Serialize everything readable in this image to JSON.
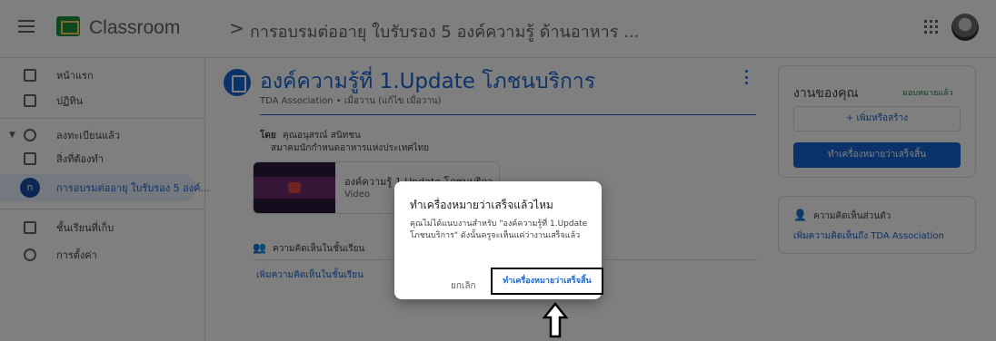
{
  "header": {
    "app_name": "Classroom",
    "separator": ">",
    "course": "การอบรมต่ออายุ ใบรับรอง 5 องค์ความรู้ ด้านอาหาร ..."
  },
  "sidebar": {
    "items": [
      {
        "label": "หน้าแรก"
      },
      {
        "label": "ปฏิทิน"
      },
      {
        "label": "ลงทะเบียนแล้ว"
      },
      {
        "label": "สิ่งที่ต้องทำ"
      },
      {
        "label": "การอบรมต่ออายุ ใบรับรอง 5 องค์...",
        "avatar": "n"
      },
      {
        "label": "ชั้นเรียนที่เก็บ"
      },
      {
        "label": "การตั้งค่า"
      }
    ]
  },
  "post": {
    "title": "องค์ความรู้ที่ 1.Update โภชนบริการ",
    "meta": "TDA Association • เมื่อวาน (แก้ไข เมื่อวาน)",
    "by_label": "โดย",
    "by_name": "คุณอนุสรณ์ สนิทชน",
    "by_org": "สมาคมนักกำหนดอาหารแห่งประเทศไทย",
    "attachment_title": "องค์ความรู้ 1.Update โภชนบริกา",
    "attachment_type": "Video",
    "class_comments_label": "ความคิดเห็นในชั้นเรียน",
    "add_class_comment": "เพิ่มความคิดเห็นในชั้นเรียน"
  },
  "your_work": {
    "title": "งานของคุณ",
    "status": "มอบหมายแล้ว",
    "add_create": "+  เพิ่มหรือสร้าง",
    "mark_done": "ทำเครื่องหมายว่าเสร็จสิ้น"
  },
  "private_comments": {
    "label": "ความคิดเห็นส่วนตัว",
    "add": "เพิ่มความคิดเห็นถึง TDA Association"
  },
  "dialog": {
    "title": "ทำเครื่องหมายว่าเสร็จแล้วไหม",
    "body": "คุณไม่ได้แนบงานสำหรับ \"องค์ความรู้ที่ 1.Update โภชนบริการ\" ดังนั้นครูจะเห็นแค่ว่างานเสร็จแล้ว",
    "cancel": "ยกเลิก",
    "confirm": "ทำเครื่องหมายว่าเสร็จสิ้น"
  },
  "colors": {
    "accent": "#1967d2",
    "status_green": "#188038"
  },
  "icons": [
    "menu-icon",
    "classroom-logo-icon",
    "apps-grid-icon",
    "home-icon",
    "calendar-icon",
    "enrolled-icon",
    "todo-icon",
    "archive-icon",
    "settings-icon",
    "assignment-icon",
    "more-vert-icon",
    "people-icon",
    "person-icon",
    "up-arrow-icon"
  ]
}
